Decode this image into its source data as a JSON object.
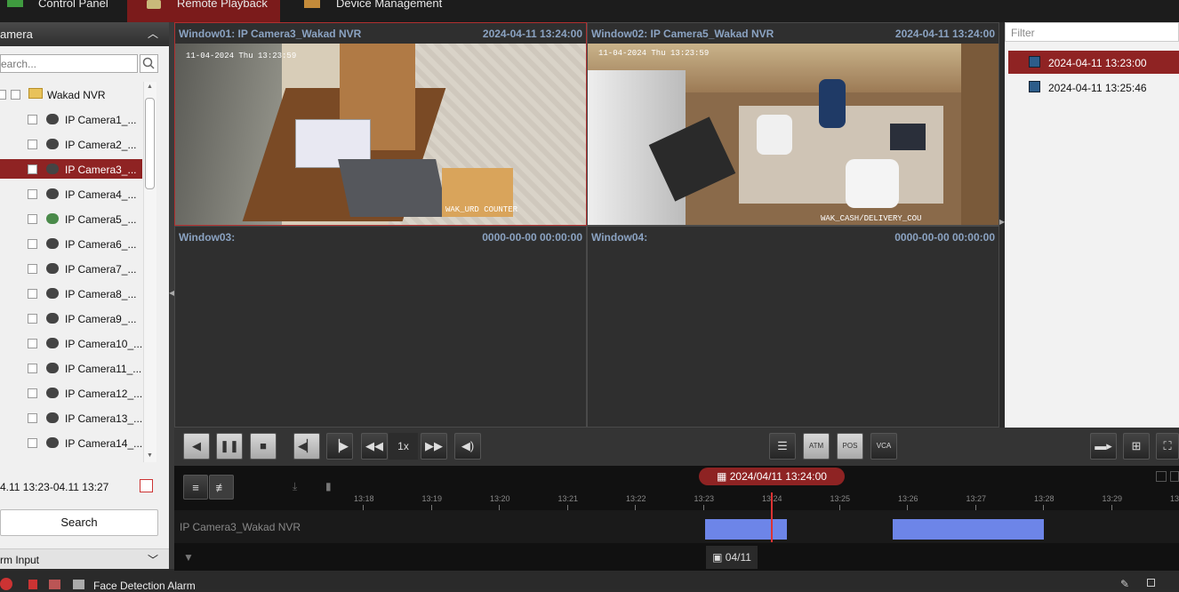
{
  "tabs": [
    {
      "label": "Control Panel"
    },
    {
      "label": "Remote Playback"
    },
    {
      "label": "Device Management"
    }
  ],
  "left_panel": {
    "title": "amera",
    "search_placeholder": "earch...",
    "root": "Wakad NVR",
    "cameras": [
      "IP Camera1_...",
      "IP Camera2_...",
      "IP Camera3_...",
      "IP Camera4_...",
      "IP Camera5_...",
      "IP Camera6_...",
      "IP Camera7_...",
      "IP Camera8_...",
      "IP Camera9_...",
      "IP Camera10_...",
      "IP Camera11_...",
      "IP Camera12_...",
      "IP Camera13_...",
      "IP Camera14_..."
    ],
    "selected_camera": "IP Camera3_...",
    "time_range": "4.11 13:23-04.11 13:27",
    "search_button": "Search",
    "alarm_input": "rm Input"
  },
  "windows": [
    {
      "title": "Window01: IP Camera3_Wakad NVR",
      "datetime": "2024-04-11 13:24:00",
      "osd_time": "11-04-2024 Thu 13:23:59",
      "osd_name": "WAK_URD COUNTER"
    },
    {
      "title": "Window02: IP Camera5_Wakad NVR",
      "datetime": "2024-04-11 13:24:00",
      "osd_time": "11-04-2024 Thu 13:23:59",
      "osd_name": "WAK_CASH/DELIVERY_COU"
    },
    {
      "title": "Window03:",
      "datetime": "0000-00-00 00:00:00"
    },
    {
      "title": "Window04:",
      "datetime": "0000-00-00 00:00:00"
    }
  ],
  "right_panel": {
    "filter_placeholder": "Filter",
    "records": [
      "2024-04-11 13:23:00",
      "2024-04-11 13:25:46"
    ]
  },
  "controls": {
    "speed": "1x",
    "atm_label": "ATM",
    "pos_label": "POS",
    "vca_label": "VCA"
  },
  "timeline": {
    "current": "2024/04/11 13:24:00",
    "ticks": [
      "13:18",
      "13:19",
      "13:20",
      "13:21",
      "13:22",
      "13:23",
      "13:24",
      "13:25",
      "13:26",
      "13:27",
      "13:28",
      "13:29",
      "13:"
    ],
    "track_label": "IP Camera3_Wakad NVR",
    "day": "04/11"
  },
  "status_bar": {
    "alarm": "Face Detection Alarm"
  },
  "colors": {
    "accent": "#8f2323",
    "segment": "#6d85e8",
    "osd_title": "#8ba3c2"
  }
}
